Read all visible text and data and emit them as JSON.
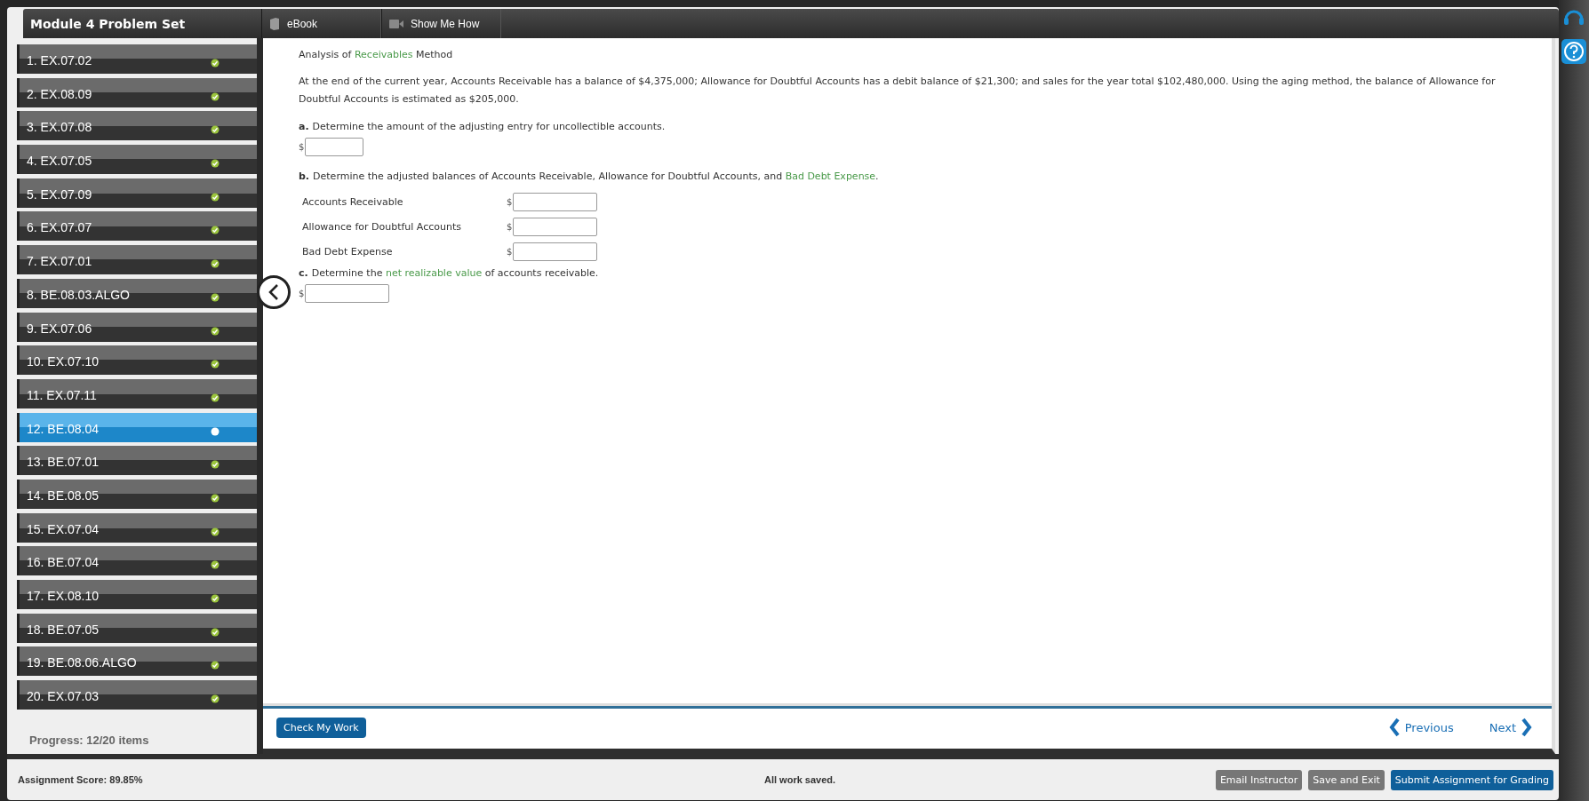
{
  "header": {
    "title": "Module 4 Problem Set",
    "tabs": [
      {
        "label": "eBook",
        "kind": "book"
      },
      {
        "label": "Show Me How",
        "kind": "video"
      }
    ]
  },
  "sidebar": {
    "items": [
      {
        "label": "1. EX.07.02",
        "selected": false
      },
      {
        "label": "2. EX.08.09",
        "selected": false
      },
      {
        "label": "3. EX.07.08",
        "selected": false
      },
      {
        "label": "4. EX.07.05",
        "selected": false
      },
      {
        "label": "5. EX.07.09",
        "selected": false
      },
      {
        "label": "6. EX.07.07",
        "selected": false
      },
      {
        "label": "7. EX.07.01",
        "selected": false
      },
      {
        "label": "8. BE.08.03.ALGO",
        "selected": false
      },
      {
        "label": "9. EX.07.06",
        "selected": false
      },
      {
        "label": "10. EX.07.10",
        "selected": false
      },
      {
        "label": "11. EX.07.11",
        "selected": false
      },
      {
        "label": "12. BE.08.04",
        "selected": true
      },
      {
        "label": "13. BE.07.01",
        "selected": false
      },
      {
        "label": "14. BE.08.05",
        "selected": false
      },
      {
        "label": "15. EX.07.04",
        "selected": false
      },
      {
        "label": "16. BE.07.04",
        "selected": false
      },
      {
        "label": "17. EX.08.10",
        "selected": false
      },
      {
        "label": "18. BE.07.05",
        "selected": false
      },
      {
        "label": "19. BE.08.06.ALGO",
        "selected": false
      },
      {
        "label": "20. EX.07.03",
        "selected": false
      }
    ],
    "progress": "Progress:  12/20 items"
  },
  "problem": {
    "title": [
      {
        "text": "Analysis of ",
        "link": false
      },
      {
        "text": "Receivables",
        "link": true
      },
      {
        "text": " Method",
        "link": false
      }
    ],
    "intro": "At the end of the current year, Accounts Receivable has a balance of $4,375,000; Allowance for Doubtful Accounts has a debit balance of $21,300; and sales for the year total $102,480,000. Using the aging method, the balance of Allowance for Doubtful Accounts is estimated as $205,000.",
    "parts": [
      {
        "letter": "a.",
        "kind": "single",
        "segments": [
          {
            "text": "Determine the amount of the adjusting entry for uncollectible accounts.",
            "link": false
          }
        ],
        "fields": [
          {
            "currency": "$"
          }
        ]
      },
      {
        "letter": "b.",
        "kind": "table",
        "segments": [
          {
            "text": "Determine the adjusted balances of Accounts Receivable, Allowance for Doubtful Accounts, and ",
            "link": false
          },
          {
            "text": "Bad Debt Expense",
            "link": true
          },
          {
            "text": ".",
            "link": false
          }
        ],
        "fields": [
          {
            "label": "Accounts Receivable",
            "currency": "$"
          },
          {
            "label": "Allowance for Doubtful Accounts",
            "currency": "$"
          },
          {
            "label": "Bad Debt Expense",
            "currency": "$"
          }
        ]
      },
      {
        "letter": "c.",
        "kind": "single",
        "segments": [
          {
            "text": "Determine the ",
            "link": false
          },
          {
            "text": "net realizable value",
            "link": true
          },
          {
            "text": " of accounts receivable.",
            "link": false
          }
        ],
        "fields": [
          {
            "currency": "$"
          }
        ]
      }
    ]
  },
  "footer": {
    "check": "Check My Work",
    "previous": "Previous",
    "next": "Next"
  },
  "status_bar": {
    "score": "Assignment Score: 89.85%",
    "saved": "All work saved.",
    "buttons": [
      {
        "label": "Email Instructor",
        "kind": "secondary"
      },
      {
        "label": "Save and Exit",
        "kind": "secondary"
      },
      {
        "label": "Submit Assignment for Grading",
        "kind": "primary"
      }
    ]
  }
}
